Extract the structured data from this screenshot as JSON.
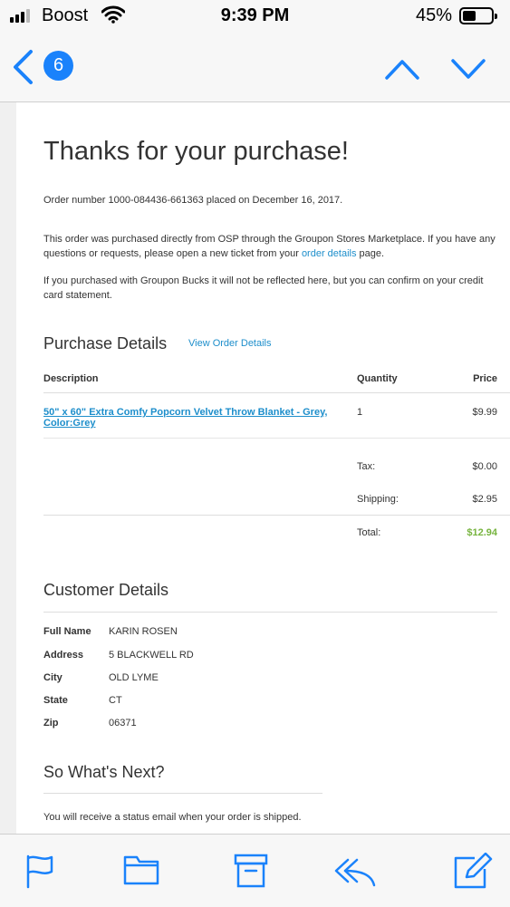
{
  "status_bar": {
    "carrier": "Boost",
    "time": "9:39 PM",
    "battery_percent": "45%",
    "battery_level": 0.45
  },
  "nav": {
    "unread_count": "6",
    "accent_color": "#1a82fb"
  },
  "email": {
    "title": "Thanks for your purchase!",
    "order_line": "Order number 1000-084436-661363 placed on December 16, 2017.",
    "marketplace_line_1": "This order was purchased directly from OSP through the Groupon Stores Marketplace. If you have any",
    "marketplace_line_2_pre": "questions or requests, please open a new ticket from your ",
    "marketplace_line_2_link": "order details",
    "marketplace_line_2_post": " page.",
    "bucks_line_1": "If you purchased with Groupon Bucks it will not be reflected here, but you can confirm on your credit",
    "bucks_line_2": "card statement.",
    "purchase_details": {
      "heading": "Purchase Details",
      "view_link": "View Order Details",
      "columns": {
        "description": "Description",
        "quantity": "Quantity",
        "price": "Price"
      },
      "item": {
        "name_line_1": "50\" x 60\" Extra Comfy Popcorn Velvet Throw Blanket - Grey,",
        "name_line_2": "Color:Grey",
        "quantity": "1",
        "price": "$9.99"
      },
      "tax_label": "Tax:",
      "tax_value": "$0.00",
      "shipping_label": "Shipping:",
      "shipping_value": "$2.95",
      "total_label": "Total:",
      "total_value": "$12.94"
    },
    "customer_details": {
      "heading": "Customer Details",
      "rows": [
        {
          "label": "Full Name",
          "value": "KARIN ROSEN"
        },
        {
          "label": "Address",
          "value": "5 BLACKWELL RD"
        },
        {
          "label": "City",
          "value": "OLD LYME"
        },
        {
          "label": "State",
          "value": "CT"
        },
        {
          "label": "Zip",
          "value": "06371"
        }
      ]
    },
    "whats_next": {
      "heading": "So What's Next?",
      "text": "You will receive a status email when your order is shipped."
    }
  },
  "tab_bar": {
    "icons": [
      "flag-icon",
      "folder-icon",
      "archive-icon",
      "reply-icon",
      "compose-icon"
    ]
  }
}
